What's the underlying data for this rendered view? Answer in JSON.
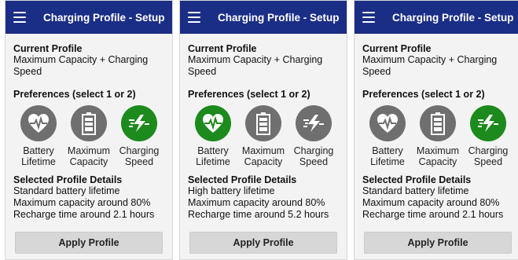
{
  "panels": [
    {
      "title": "Charging Profile - Setup",
      "current_profile_heading": "Current Profile",
      "current_profile_value": "Maximum Capacity + Charging Speed",
      "preferences_heading": "Preferences (select 1 or 2)",
      "options": [
        {
          "label_1": "Battery",
          "label_2": "Lifetime",
          "icon": "heart-pulse-icon",
          "selected": false
        },
        {
          "label_1": "Maximum",
          "label_2": "Capacity",
          "icon": "battery-icon",
          "selected": false
        },
        {
          "label_1": "Charging",
          "label_2": "Speed",
          "icon": "lightning-icon",
          "selected": true
        }
      ],
      "details_heading": "Selected Profile Details",
      "details": [
        "Standard battery lifetime",
        "Maximum capacity around 80%",
        "Recharge time around 2.1 hours"
      ],
      "apply_label": "Apply Profile"
    },
    {
      "title": "Charging Profile - Setup",
      "current_profile_heading": "Current Profile",
      "current_profile_value": "Maximum Capacity + Charging Speed",
      "preferences_heading": "Preferences (select 1 or 2)",
      "options": [
        {
          "label_1": "Battery",
          "label_2": "Lifetime",
          "icon": "heart-pulse-icon",
          "selected": true
        },
        {
          "label_1": "Maximum",
          "label_2": "Capacity",
          "icon": "battery-icon",
          "selected": false
        },
        {
          "label_1": "Charging",
          "label_2": "Speed",
          "icon": "lightning-icon",
          "selected": false
        }
      ],
      "details_heading": "Selected Profile Details",
      "details": [
        "High battery lifetime",
        "Maximum capacity around 80%",
        "Recharge time around 5.2 hours"
      ],
      "apply_label": "Apply Profile"
    },
    {
      "title": "Charging Profile - Setup",
      "current_profile_heading": "Current Profile",
      "current_profile_value": "Maximum Capacity + Charging Speed",
      "preferences_heading": "Preferences (select 1 or 2)",
      "options": [
        {
          "label_1": "Battery",
          "label_2": "Lifetime",
          "icon": "heart-pulse-icon",
          "selected": false
        },
        {
          "label_1": "Maximum",
          "label_2": "Capacity",
          "icon": "battery-icon",
          "selected": false
        },
        {
          "label_1": "Charging",
          "label_2": "Speed",
          "icon": "lightning-icon",
          "selected": true
        }
      ],
      "details_heading": "Selected Profile Details",
      "details": [
        "Standard battery lifetime",
        "Maximum capacity around 80%",
        "Recharge time around 2.1 hours"
      ],
      "apply_label": "Apply Profile"
    }
  ],
  "colors": {
    "appbar": "#1a2e86",
    "selected": "#1c8a1c",
    "unselected": "#6f6f6f",
    "button": "#d7d7d7"
  }
}
